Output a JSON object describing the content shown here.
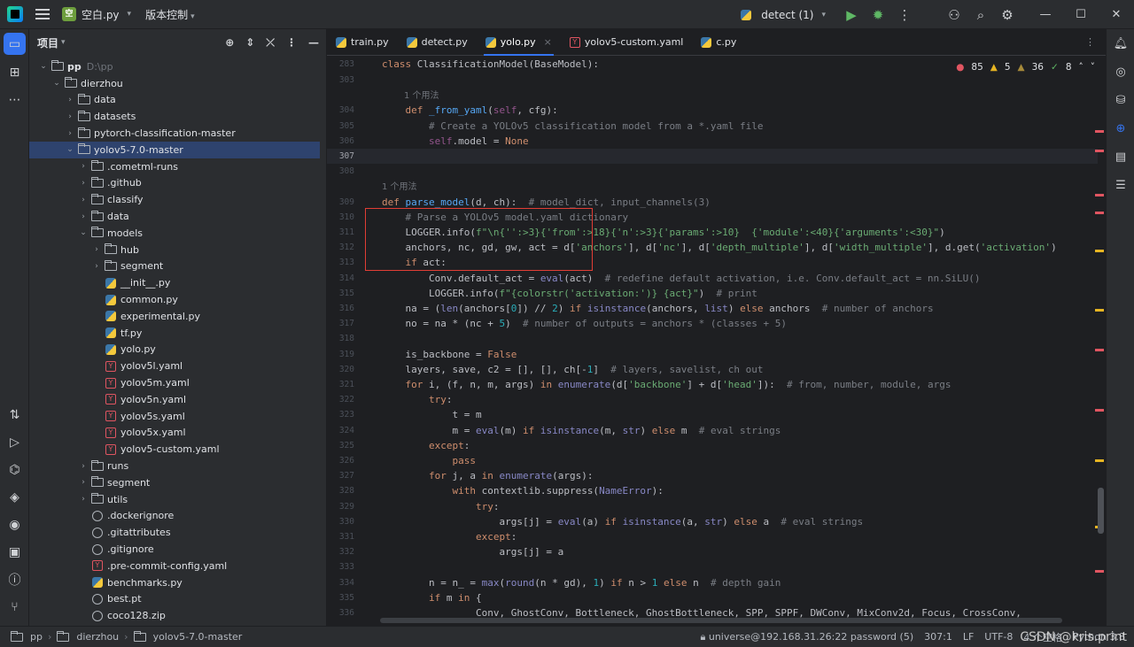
{
  "titlebar": {
    "project_badge": "空",
    "project_name": "空白.py",
    "vcs": "版本控制",
    "run_config": "detect (1)"
  },
  "project_panel": {
    "title": "项目",
    "tree": [
      {
        "depth": 0,
        "arrow": "v",
        "kind": "folder",
        "label": "pp",
        "hint": "D:\\pp",
        "bold": true
      },
      {
        "depth": 1,
        "arrow": "v",
        "kind": "folder",
        "label": "dierzhou"
      },
      {
        "depth": 2,
        "arrow": ">",
        "kind": "folder",
        "label": "data"
      },
      {
        "depth": 2,
        "arrow": ">",
        "kind": "folder",
        "label": "datasets"
      },
      {
        "depth": 2,
        "arrow": ">",
        "kind": "folder",
        "label": "pytorch-classification-master"
      },
      {
        "depth": 2,
        "arrow": "v",
        "kind": "folder",
        "label": "yolov5-7.0-master",
        "selected": true
      },
      {
        "depth": 3,
        "arrow": ">",
        "kind": "folder",
        "label": ".cometml-runs"
      },
      {
        "depth": 3,
        "arrow": ">",
        "kind": "folder",
        "label": ".github"
      },
      {
        "depth": 3,
        "arrow": ">",
        "kind": "folder",
        "label": "classify"
      },
      {
        "depth": 3,
        "arrow": ">",
        "kind": "folder",
        "label": "data"
      },
      {
        "depth": 3,
        "arrow": "v",
        "kind": "folder",
        "label": "models"
      },
      {
        "depth": 4,
        "arrow": ">",
        "kind": "folder",
        "label": "hub"
      },
      {
        "depth": 4,
        "arrow": ">",
        "kind": "folder",
        "label": "segment"
      },
      {
        "depth": 4,
        "arrow": "",
        "kind": "py",
        "label": "__init__.py"
      },
      {
        "depth": 4,
        "arrow": "",
        "kind": "py",
        "label": "common.py"
      },
      {
        "depth": 4,
        "arrow": "",
        "kind": "py",
        "label": "experimental.py"
      },
      {
        "depth": 4,
        "arrow": "",
        "kind": "py",
        "label": "tf.py"
      },
      {
        "depth": 4,
        "arrow": "",
        "kind": "py",
        "label": "yolo.py"
      },
      {
        "depth": 4,
        "arrow": "",
        "kind": "yml",
        "label": "yolov5l.yaml"
      },
      {
        "depth": 4,
        "arrow": "",
        "kind": "yml",
        "label": "yolov5m.yaml"
      },
      {
        "depth": 4,
        "arrow": "",
        "kind": "yml",
        "label": "yolov5n.yaml"
      },
      {
        "depth": 4,
        "arrow": "",
        "kind": "yml",
        "label": "yolov5s.yaml"
      },
      {
        "depth": 4,
        "arrow": "",
        "kind": "yml",
        "label": "yolov5x.yaml"
      },
      {
        "depth": 4,
        "arrow": "",
        "kind": "yml",
        "label": "yolov5-custom.yaml"
      },
      {
        "depth": 3,
        "arrow": ">",
        "kind": "folder",
        "label": "runs"
      },
      {
        "depth": 3,
        "arrow": ">",
        "kind": "folder",
        "label": "segment"
      },
      {
        "depth": 3,
        "arrow": ">",
        "kind": "folder",
        "label": "utils"
      },
      {
        "depth": 3,
        "arrow": "",
        "kind": "gen",
        "label": ".dockerignore"
      },
      {
        "depth": 3,
        "arrow": "",
        "kind": "gen",
        "label": ".gitattributes"
      },
      {
        "depth": 3,
        "arrow": "",
        "kind": "gen",
        "label": ".gitignore"
      },
      {
        "depth": 3,
        "arrow": "",
        "kind": "yml",
        "label": ".pre-commit-config.yaml"
      },
      {
        "depth": 3,
        "arrow": "",
        "kind": "py",
        "label": "benchmarks.py"
      },
      {
        "depth": 3,
        "arrow": "",
        "kind": "gen",
        "label": "best.pt"
      },
      {
        "depth": 3,
        "arrow": "",
        "kind": "gen",
        "label": "coco128.zip"
      }
    ]
  },
  "tabs": [
    {
      "label": "train.py",
      "kind": "py",
      "active": false
    },
    {
      "label": "detect.py",
      "kind": "py",
      "active": false
    },
    {
      "label": "yolo.py",
      "kind": "py",
      "active": true
    },
    {
      "label": "yolov5-custom.yaml",
      "kind": "yml",
      "active": false
    },
    {
      "label": "c.py",
      "kind": "py",
      "active": false
    }
  ],
  "inspections": {
    "errors": "85",
    "warnings": "5",
    "weak": "36",
    "ok": "8"
  },
  "code": {
    "sticky_header": "class ClassificationModel(BaseModel):",
    "lines": [
      {
        "n": "303",
        "html": ""
      },
      {
        "n": "",
        "html": "<span class='usage'>1 个用法</span>",
        "usage": true
      },
      {
        "n": "304",
        "html": "    <span class='k'>def</span> <span class='f'>_from_yaml</span>(<span class='sf'>self</span>, cfg):"
      },
      {
        "n": "305",
        "html": "        <span class='c'># Create a YOLOv5 classification model from a *.yaml file</span>"
      },
      {
        "n": "306",
        "html": "        <span class='sf'>self</span>.model = <span class='k'>None</span>"
      },
      {
        "n": "307",
        "html": "",
        "current": true
      },
      {
        "n": "308",
        "html": ""
      },
      {
        "n": "",
        "html": "<span class='usage'>1 个用法</span>",
        "usage": true
      },
      {
        "n": "309",
        "html": "<span class='k'>def</span> <span class='f'>parse_model</span>(d, ch):  <span class='c'># model_dict, input_channels(3)</span>"
      },
      {
        "n": "310",
        "html": "    <span class='c'># Parse a YOLOv5 model.yaml dictionary</span>"
      },
      {
        "n": "311",
        "html": "    LOGGER.info(<span class='s'>f\"\\n{'':>3}{'from':>18}{'n':>3}{'params':>10}  {'module':<40}{'arguments':<30}\"</span>)"
      },
      {
        "n": "312",
        "html": "    anchors, nc, gd, gw, act = d[<span class='s'>'anchors'</span>], d[<span class='s'>'nc'</span>], d[<span class='s'>'depth_multiple'</span>], d[<span class='s'>'width_multiple'</span>], d.get(<span class='s'>'activation'</span>)"
      },
      {
        "n": "313",
        "html": "    <span class='k'>if</span> act:"
      },
      {
        "n": "314",
        "html": "        Conv.default_act = <span class='b'>eval</span>(act)  <span class='c'># redefine default activation, i.e. Conv.default_act = nn.SiLU()</span>"
      },
      {
        "n": "315",
        "html": "        LOGGER.info(<span class='s'>f\"{colorstr('activation:')} {act}\"</span>)  <span class='c'># print</span>"
      },
      {
        "n": "316",
        "html": "    na = (<span class='b'>len</span>(anchors[<span class='n'>0</span>]) // <span class='n'>2</span>) <span class='k'>if</span> <span class='b'>isinstance</span>(anchors, <span class='b'>list</span>) <span class='k'>else</span> anchors  <span class='c'># number of anchors</span>"
      },
      {
        "n": "317",
        "html": "    no = na * (nc + <span class='n'>5</span>)  <span class='c'># number of outputs = anchors * (classes + 5)</span>"
      },
      {
        "n": "318",
        "html": ""
      },
      {
        "n": "319",
        "html": "    is_backbone = <span class='k'>False</span>"
      },
      {
        "n": "320",
        "html": "    layers, save, c2 = [], [], ch[-<span class='n'>1</span>]  <span class='c'># layers, savelist, ch out</span>"
      },
      {
        "n": "321",
        "html": "    <span class='k'>for</span> i, (f, n, m, args) <span class='k'>in</span> <span class='b'>enumerate</span>(d[<span class='s'>'backbone'</span>] + d[<span class='s'>'head'</span>]):  <span class='c'># from, number, module, args</span>"
      },
      {
        "n": "322",
        "html": "        <span class='k'>try</span>:"
      },
      {
        "n": "323",
        "html": "            t = m"
      },
      {
        "n": "324",
        "html": "            m = <span class='b'>eval</span>(m) <span class='k'>if</span> <span class='b'>isinstance</span>(m, <span class='b'>str</span>) <span class='k'>else</span> m  <span class='c'># eval strings</span>"
      },
      {
        "n": "325",
        "html": "        <span class='k'>except</span>:"
      },
      {
        "n": "326",
        "html": "            <span class='k'>pass</span>"
      },
      {
        "n": "327",
        "html": "        <span class='k'>for</span> j, a <span class='k'>in</span> <span class='b'>enumerate</span>(args):"
      },
      {
        "n": "328",
        "html": "            <span class='k'>with</span> contextlib.suppress(<span class='b'>NameError</span>):"
      },
      {
        "n": "329",
        "html": "                <span class='k'>try</span>:"
      },
      {
        "n": "330",
        "html": "                    args[j] = <span class='b'>eval</span>(a) <span class='k'>if</span> <span class='b'>isinstance</span>(a, <span class='b'>str</span>) <span class='k'>else</span> a  <span class='c'># eval strings</span>"
      },
      {
        "n": "331",
        "html": "                <span class='k'>except</span>:"
      },
      {
        "n": "332",
        "html": "                    args[j] = a"
      },
      {
        "n": "333",
        "html": ""
      },
      {
        "n": "334",
        "html": "        n = n_ = <span class='b'>max</span>(<span class='b'>round</span>(n * gd), <span class='n'>1</span>) <span class='k'>if</span> n > <span class='n'>1</span> <span class='k'>else</span> n  <span class='c'># depth gain</span>"
      },
      {
        "n": "335",
        "html": "        <span class='k'>if</span> m <span class='k'>in</span> {"
      },
      {
        "n": "336",
        "html": "                Conv, GhostConv, Bottleneck, GhostBottleneck, SPP, SPPF, DWConv, MixConv2d, Focus, CrossConv,"
      }
    ]
  },
  "statusbar": {
    "crumbs": [
      "pp",
      "dierzhou",
      "yolov5-7.0-master"
    ],
    "interpreter": "universe@192.168.31.26:22 password (5)",
    "position": "307:1",
    "line_sep": "LF",
    "encoding": "UTF-8",
    "indent": "4 个空格",
    "lang": "Python 3.8",
    "watermark": "CSDN @kris.print"
  },
  "colors": {
    "accent": "#3574f0",
    "error": "#e05561",
    "warning": "#e6b422",
    "highlight_box": "#e13e35"
  }
}
